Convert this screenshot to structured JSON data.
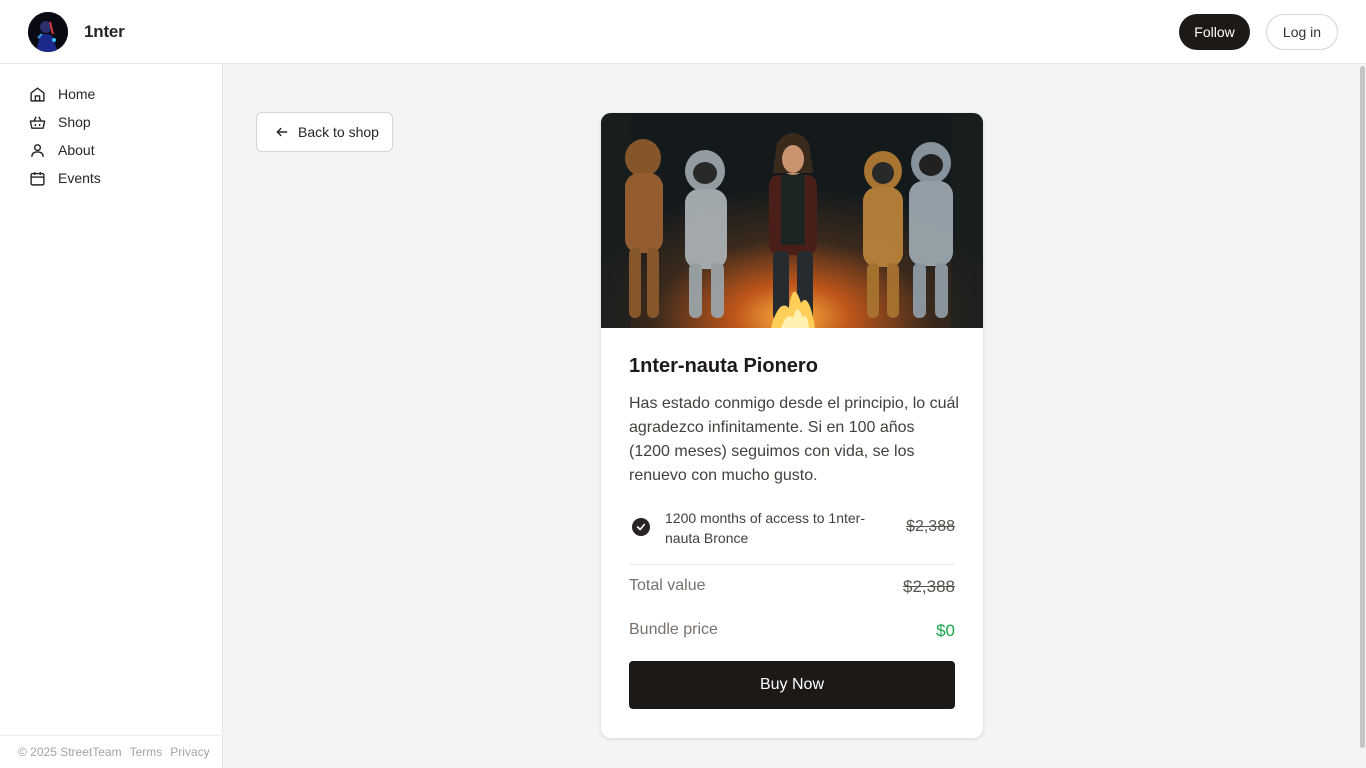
{
  "header": {
    "brand": "1nter",
    "follow_label": "Follow",
    "login_label": "Log in"
  },
  "sidebar": {
    "items": [
      {
        "label": "Home",
        "icon": "home-icon"
      },
      {
        "label": "Shop",
        "icon": "basket-icon"
      },
      {
        "label": "About",
        "icon": "user-icon"
      },
      {
        "label": "Events",
        "icon": "calendar-icon"
      }
    ],
    "footer": {
      "copyright": "© 2025 StreetTeam",
      "terms": "Terms",
      "privacy": "Privacy"
    }
  },
  "main": {
    "back_label": "Back to shop",
    "product": {
      "title": "1nter-nauta Pionero",
      "description": "Has estado conmigo desde el principio, lo cuál agradezco infinitamente. Si en 100 años (1200 meses) seguimos con vida, se los renuevo con mucho gusto.",
      "items": [
        {
          "text": "1200 months of access to 1nter-nauta Bronce",
          "price": "$2,388"
        }
      ],
      "total_label": "Total value",
      "total_value": "$2,388",
      "bundle_label": "Bundle price",
      "bundle_value": "$0",
      "buy_label": "Buy Now"
    }
  },
  "colors": {
    "accent": "#1c1917",
    "price_green": "#16a34a"
  }
}
